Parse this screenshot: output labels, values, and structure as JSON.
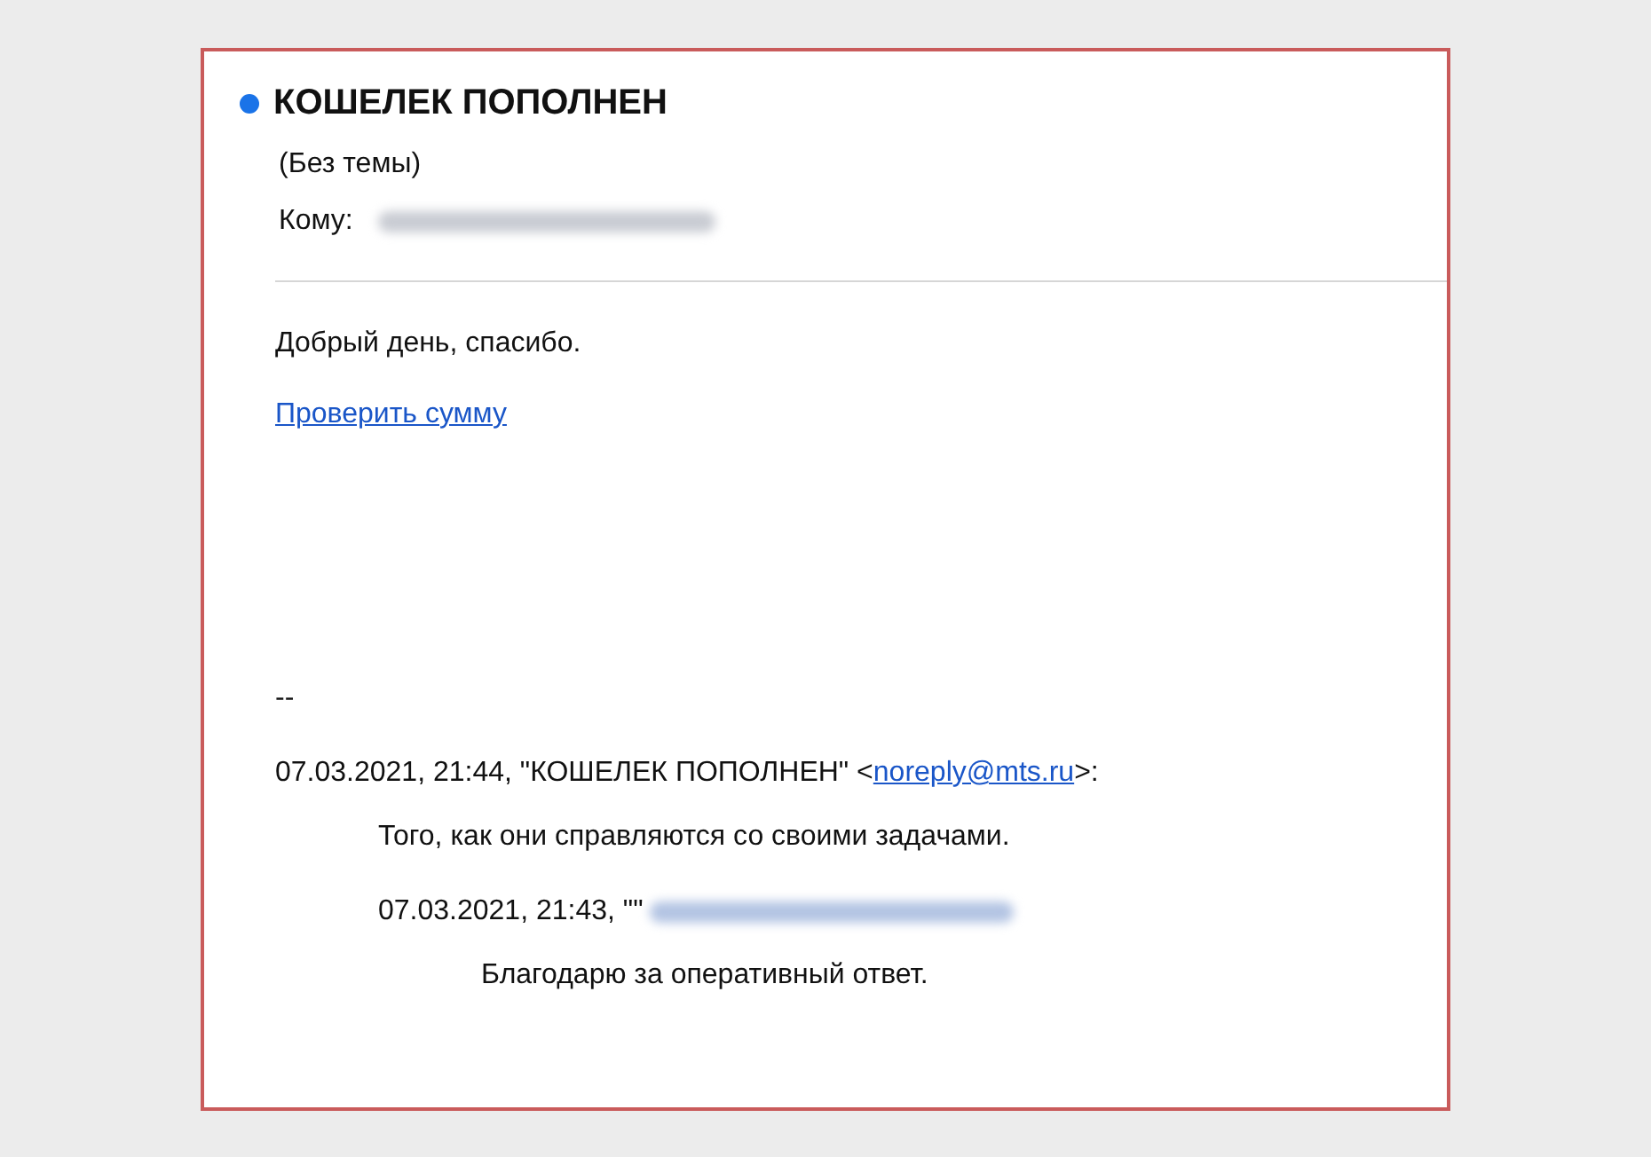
{
  "header": {
    "unread": true,
    "sender": "КОШЕЛЕК ПОПОЛНЕН",
    "subject": "(Без темы)",
    "to_label": "Кому:",
    "to_redacted": true
  },
  "body": {
    "greeting": "Добрый день, спасибо.",
    "link": "Проверить сумму",
    "separator": "--"
  },
  "quotes": [
    {
      "header_prefix": "07.03.2021, 21:44, \"КОШЕЛЕК ПОПОЛНЕН\" <",
      "email": "noreply@mts.ru",
      "header_suffix": ">:",
      "kind": "link",
      "text": "Того, как они справляются со своими задачами.",
      "children": [
        {
          "header_prefix": "07.03.2021, 21:43, \"\"",
          "kind": "redacted",
          "text": "Благодарю за оперативный ответ."
        }
      ]
    }
  ]
}
